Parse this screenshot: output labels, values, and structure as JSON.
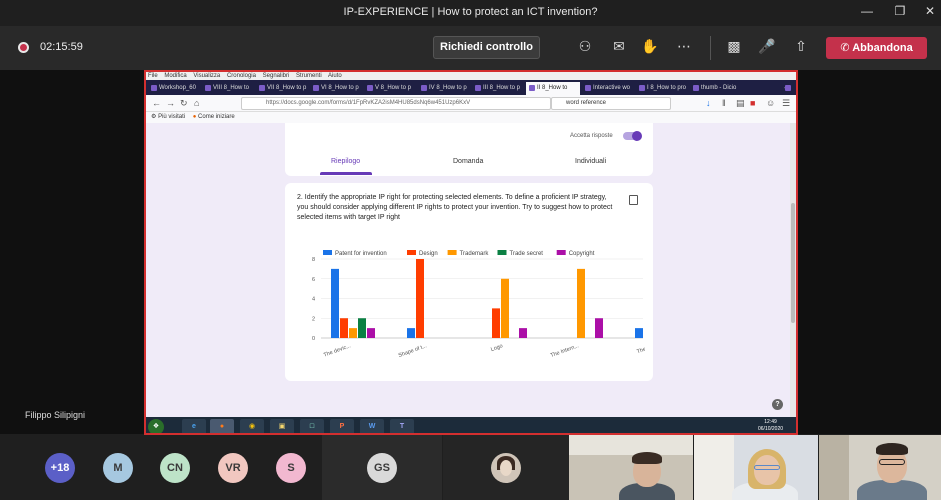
{
  "window": {
    "title": "IP-EXPERIENCE | How to protect an ICT invention?"
  },
  "meeting": {
    "timer": "02:15:59",
    "request_control": "Richiedi controllo",
    "leave": "Abbandona",
    "presenter": "Filippo Silipigni"
  },
  "browser": {
    "menu": [
      "File",
      "Modifica",
      "Visualizza",
      "Cronologia",
      "Segnalibri",
      "Strumenti",
      "Aiuto"
    ],
    "tabs": [
      "Workshop_60",
      "VIII 8_How to",
      "VII 8_How to p",
      "VI 8_How to p",
      "V 8_How to p",
      "IV 8_How to p",
      "III 8_How to p",
      "II 8_How to",
      "Interactive wo",
      "I 8_How to pro",
      "thumb - Dicio"
    ],
    "url": "https://docs.google.com/forms/d/1FpRvKZA2isM4HU85dsNq6w451Uzp6KxV",
    "search": "word reference",
    "bookmarks": [
      "Più visitati",
      "Come iniziare"
    ]
  },
  "form": {
    "accept_responses": "Accetta risposte",
    "tabs": [
      "Riepilogo",
      "Domanda",
      "Individuali"
    ],
    "question": "2. Identify the appropriate IP right for protecting selected elements. To define a proficient IP strategy, you should consider applying different IP rights to protect your invention. Try to suggest how to protect selected items with target IP right"
  },
  "chart_data": {
    "type": "bar",
    "categories": [
      "The devic...",
      "Shape of t...",
      "Logo",
      "The Intern...",
      "The o..."
    ],
    "series": [
      {
        "name": "Patent for invention",
        "color": "#1a73e8",
        "values": [
          7,
          1,
          0,
          0,
          1
        ]
      },
      {
        "name": "Design",
        "color": "#ff3d00",
        "values": [
          2,
          8,
          3,
          0,
          0
        ]
      },
      {
        "name": "Trademark",
        "color": "#ff9800",
        "values": [
          1,
          0,
          6,
          7,
          0
        ]
      },
      {
        "name": "Trade secret",
        "color": "#0b8043",
        "values": [
          2,
          0,
          0,
          0,
          0
        ]
      },
      {
        "name": "Copyright",
        "color": "#ab0fa7",
        "values": [
          1,
          0,
          1,
          2,
          0
        ]
      }
    ],
    "yticks": [
      "0",
      "2",
      "4",
      "6",
      "8"
    ],
    "ylim": [
      0,
      8
    ],
    "grid": true,
    "legend": "top"
  },
  "taskbar": {
    "time": "12:49",
    "date": "06/10/2020"
  },
  "participants": {
    "more": "+18",
    "avatars": [
      {
        "initials": "M",
        "color": "#a6c8e0"
      },
      {
        "initials": "CN",
        "color": "#bde3c8"
      },
      {
        "initials": "VR",
        "color": "#f1c7c0"
      },
      {
        "initials": "S",
        "color": "#f2b8d0"
      }
    ],
    "tile": {
      "initials": "GS",
      "color": "#d9d9d9"
    },
    "more_color": "#5b5fc7"
  },
  "help": "?"
}
